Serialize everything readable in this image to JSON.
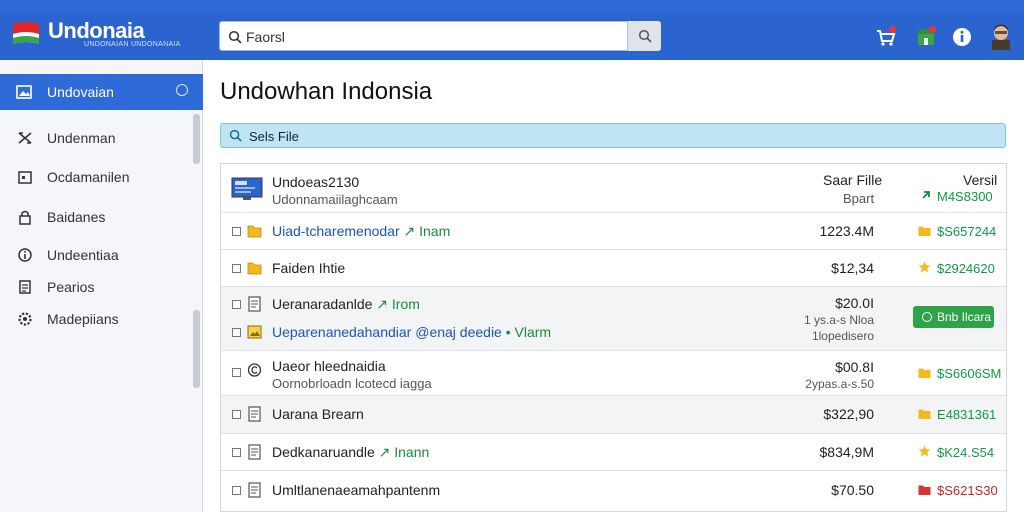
{
  "brand": {
    "name": "Undonaia",
    "subtitle": "UNDONAIAN UNDONANAIA"
  },
  "header": {
    "search_value": "Faorsl",
    "icons": [
      "cart-icon",
      "store-icon",
      "info-icon",
      "user-avatar"
    ]
  },
  "sidebar": {
    "active": {
      "label": "Undovaian",
      "icon": "image-icon"
    },
    "items": [
      {
        "label": "Undenman",
        "icon": "shuffle-icon"
      },
      {
        "label": "Ocdamanilen",
        "icon": "calendar-icon"
      },
      {
        "label": "Baidanes",
        "icon": "lock-icon"
      },
      {
        "label": "Undeentiaa",
        "icon": "info-circle-icon"
      },
      {
        "label": "Pearios",
        "icon": "document-icon"
      },
      {
        "label": "Madepiians",
        "icon": "gear-icon"
      }
    ]
  },
  "main": {
    "title": "Undowhan Indonsia",
    "filter_label": "Sels File"
  },
  "table": {
    "header": {
      "title": "Undoeas2130",
      "subtitle": "Udonnamaiilaghcaam",
      "col_size": "Saar Fille",
      "col_size_sub": "Bpart",
      "col_version": "Versil",
      "col_version_sub": "M4S8300"
    },
    "rows": [
      {
        "title": "Uiad-tcharemenodar",
        "accent": "↗ Inam",
        "amount": "1223.4M",
        "version": "$S657244",
        "vicon": "folder-icon"
      },
      {
        "title": "Faiden Ihtie",
        "accent": "",
        "amount": "$12,34",
        "version": "$2924620",
        "vicon": "star-icon"
      },
      {
        "title": "Ueranaradanlde",
        "accent": "↗ Irom",
        "title2": "Ueparenanedahandiar @enaj deedie",
        "accent2": "• Vlarm",
        "amount": "$20.0I",
        "amount2": "1 ys.a-s Nloa",
        "amount3": "1lopedisero",
        "button": "Bnb Ilcara"
      },
      {
        "title": "Uaeor hleednaidia",
        "subtitle": "Oornobrloadn lcotecd iagga",
        "amount": "$00.8I",
        "amount2": "2ypas.a-s.50",
        "version": "$S6606SM",
        "vicon": "folder-icon"
      },
      {
        "title": "Uarana Brearn",
        "accent": "",
        "amount": "$322,90",
        "version": "E4831361",
        "vicon": "folder-icon"
      },
      {
        "title": "Dedkanaruandle",
        "accent": "↗ Inann",
        "amount": "$834,9M",
        "version": "$K24.S54",
        "vicon": "star-icon"
      },
      {
        "title": "Umltlanenaeamahpantenm",
        "accent": "",
        "amount": "$70.50",
        "version": "$S621S30",
        "vicon": "red-folder-icon"
      }
    ]
  }
}
